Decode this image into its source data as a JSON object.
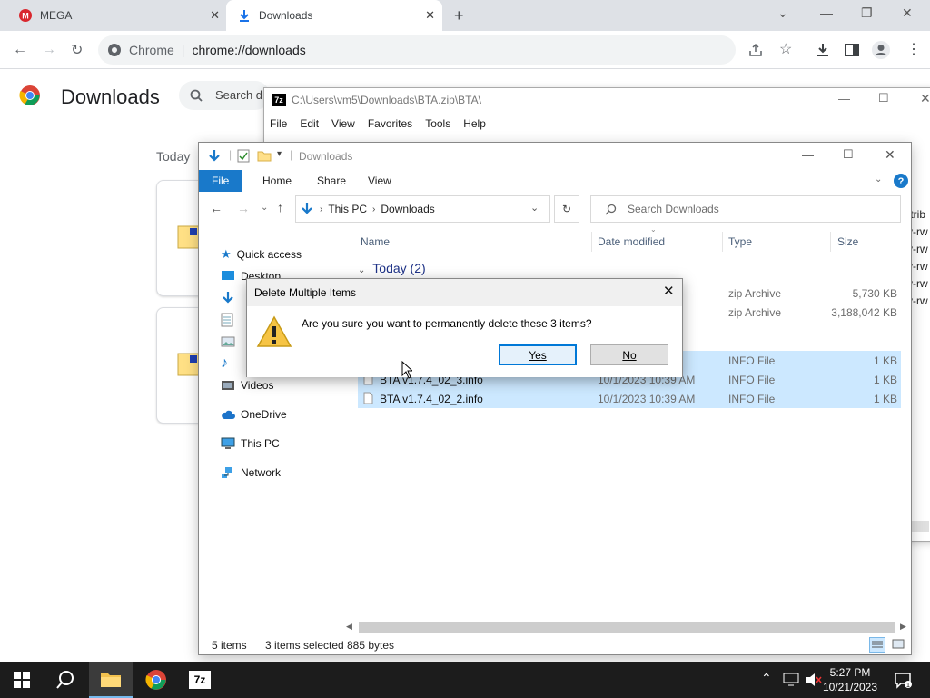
{
  "chrome": {
    "tabs": [
      {
        "title": "MEGA"
      },
      {
        "title": "Downloads"
      }
    ],
    "omnibox": {
      "site": "Chrome",
      "url": "chrome://downloads"
    }
  },
  "downloads_page": {
    "title": "Downloads",
    "search_placeholder": "Search d",
    "group_today": "Today"
  },
  "sevenzip": {
    "title": "C:\\Users\\vm5\\Downloads\\BTA.zip\\BTA\\",
    "menu": [
      "File",
      "Edit",
      "View",
      "Favorites",
      "Tools",
      "Help"
    ],
    "attr_header": "ttrib",
    "attr_rows": [
      "v-rw",
      "v-rw",
      "v-rw",
      "v-rw",
      "v-rw"
    ]
  },
  "explorer": {
    "title": "Downloads",
    "ribbon": {
      "file": "File",
      "home": "Home",
      "share": "Share",
      "view": "View"
    },
    "breadcrumb": [
      "This PC",
      "Downloads"
    ],
    "search_placeholder": "Search Downloads",
    "nav": {
      "quick_access": "Quick access",
      "desktop": "Desktop",
      "videos": "Videos",
      "onedrive": "OneDrive",
      "this_pc": "This PC",
      "network": "Network"
    },
    "columns": {
      "name": "Name",
      "date": "Date modified",
      "type": "Type",
      "size": "Size"
    },
    "group": "Today (2)",
    "files": [
      {
        "name": "",
        "date": "AM",
        "type": "zip Archive",
        "size": "5,730 KB"
      },
      {
        "name": "",
        "date": "AM",
        "type": "zip Archive",
        "size": "3,188,042 KB"
      },
      {
        "name": "",
        "date": "AM",
        "type": "INFO File",
        "size": "1 KB"
      },
      {
        "name": "BTA v1.7.4_02_3.info",
        "date": "10/1/2023 10:39 AM",
        "type": "INFO File",
        "size": "1 KB"
      },
      {
        "name": "BTA v1.7.4_02_2.info",
        "date": "10/1/2023 10:39 AM",
        "type": "INFO File",
        "size": "1 KB"
      }
    ],
    "status": {
      "items": "5 items",
      "selected": "3 items selected",
      "bytes": "885 bytes"
    }
  },
  "dialog": {
    "title": "Delete Multiple Items",
    "message": "Are you sure you want to permanently delete these 3 items?",
    "yes": "Yes",
    "no": "No"
  },
  "taskbar": {
    "time": "5:27 PM",
    "date": "10/21/2023"
  },
  "colors": {
    "accent": "#1979ca",
    "selection": "#cce8ff",
    "taskbar": "#1c1c1c"
  }
}
